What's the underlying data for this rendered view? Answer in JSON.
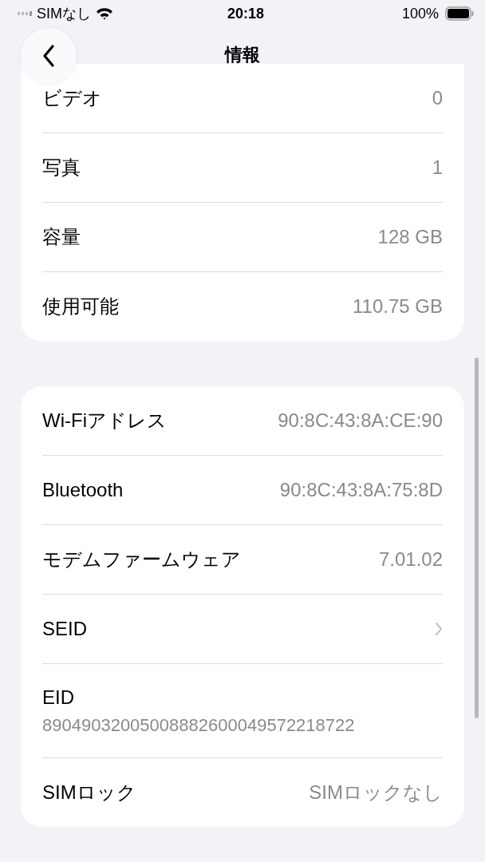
{
  "status_bar": {
    "carrier": "SIMなし",
    "time": "20:18",
    "battery": "100%"
  },
  "nav": {
    "title": "情報"
  },
  "sections": [
    {
      "rows": [
        {
          "kind": "value",
          "label": "ビデオ",
          "value": "0"
        },
        {
          "kind": "value",
          "label": "写真",
          "value": "1"
        },
        {
          "kind": "value",
          "label": "容量",
          "value": "128 GB"
        },
        {
          "kind": "value",
          "label": "使用可能",
          "value": "110.75 GB"
        }
      ]
    },
    {
      "rows": [
        {
          "kind": "value",
          "label": "Wi-Fiアドレス",
          "value": "90:8C:43:8A:CE:90"
        },
        {
          "kind": "value",
          "label": "Bluetooth",
          "value": "90:8C:43:8A:75:8D"
        },
        {
          "kind": "value",
          "label": "モデムファームウェア",
          "value": "7.01.02"
        },
        {
          "kind": "chevron",
          "label": "SEID"
        },
        {
          "kind": "stacked",
          "label": "EID",
          "value": "89049032005008882600049572218722"
        },
        {
          "kind": "value",
          "label": "SIMロック",
          "value": "SIMロックなし"
        }
      ]
    }
  ]
}
